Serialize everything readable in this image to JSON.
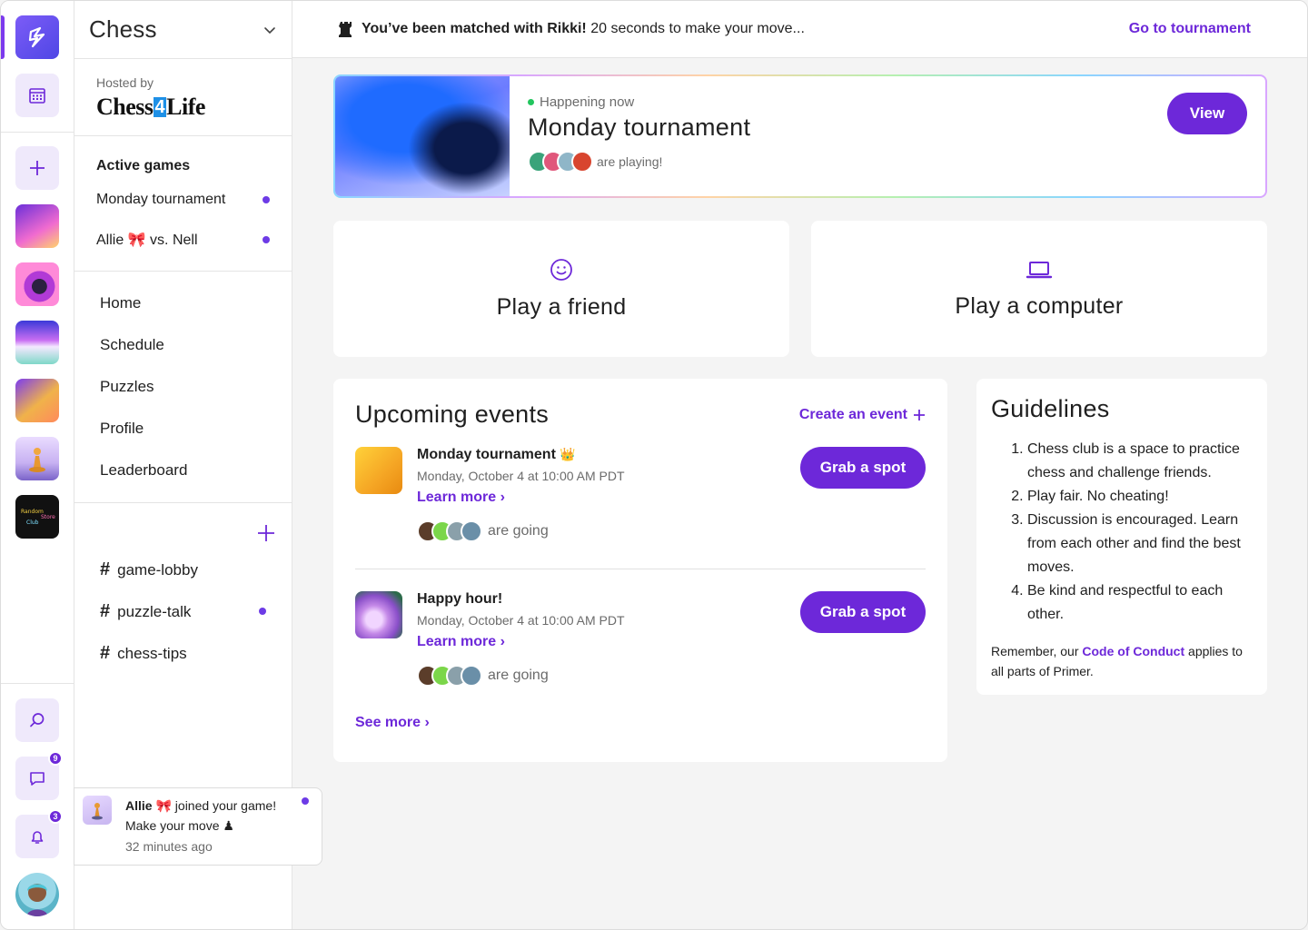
{
  "app": {
    "community_name": "Chess",
    "host_label": "Hosted by",
    "host_name_part1": "Chess",
    "host_name_part2": "4",
    "host_name_part3": "Life"
  },
  "rail": {
    "message_badge": "9",
    "notification_badge": "3"
  },
  "sidebar": {
    "active_games_title": "Active games",
    "active_games": [
      {
        "label": "Monday tournament",
        "unread": true
      },
      {
        "label": "Allie 🎀 vs. Nell",
        "unread": true
      }
    ],
    "nav": [
      "Home",
      "Schedule",
      "Puzzles",
      "Profile",
      "Leaderboard"
    ],
    "channels": [
      {
        "name": "game-lobby",
        "unread": false
      },
      {
        "name": "puzzle-talk",
        "unread": true
      },
      {
        "name": "chess-tips",
        "unread": false
      }
    ]
  },
  "topbar": {
    "match_bold": "You’ve been matched with Rikki!",
    "match_rest": "20 seconds to make your move...",
    "goto_link": "Go to tournament"
  },
  "featured": {
    "status": "Happening now",
    "title": "Monday tournament",
    "playing_text": "are playing!",
    "view_button": "View"
  },
  "play": {
    "friend_label": "Play a friend",
    "computer_label": "Play a computer"
  },
  "events": {
    "title": "Upcoming events",
    "create_link": "Create an event",
    "items": [
      {
        "name": "Monday tournament",
        "date": "Monday, October 4 at 10:00 AM PDT",
        "learn_more": "Learn more",
        "going_text": "are going",
        "button": "Grab a spot"
      },
      {
        "name": "Happy hour!",
        "date": "Monday, October 4 at 10:00 AM PDT",
        "learn_more": "Learn more",
        "going_text": "are going",
        "button": "Grab a spot"
      }
    ],
    "see_more": "See more"
  },
  "guidelines": {
    "title": "Guidelines",
    "rules": [
      "Chess club is a space to practice chess and challenge friends.",
      "Play fair. No cheating!",
      "Discussion is encouraged. Learn from each other and find the best moves.",
      "Be kind and respectful to each other."
    ],
    "note_before": "Remember, our ",
    "note_link": "Code of Conduct",
    "note_after": " applies to all parts of Primer."
  },
  "toast": {
    "user": "Allie",
    "message": " joined your game!",
    "line2": "Make your move ♟",
    "time": "32 minutes ago"
  },
  "colors": {
    "accent": "#6d28d9",
    "background": "#f4f4f4",
    "live": "#22c55e"
  }
}
